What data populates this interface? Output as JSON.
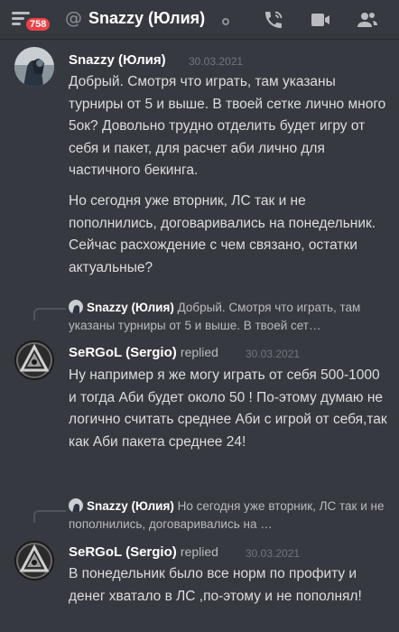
{
  "header": {
    "unread_count": "758",
    "at_symbol": "@",
    "channel_title": "Snazzy (Юлия)"
  },
  "messages": [
    {
      "author": "Snazzy (Юлия)",
      "timestamp": "30.03.2021",
      "paragraphs": [
        "Добрый. Смотря что играть, там указаны турниры от 5 и выше. В твоей сетке лично много 5ок? Довольно трудно отделить будет игру от себя и пакет, для расчет аби лично для частичного бекинга.",
        "Но сегодня уже вторник, ЛС так и не пополнились, договаривались на понедельник. Сейчас расхождение с чем связано, остатки актуальные?"
      ]
    },
    {
      "reply_author": "Snazzy (Юлия)",
      "reply_text": "Добрый. Смотря что играть, там указаны турниры от 5 и выше. В твоей сет…",
      "author": "SeRGoL (Sergio)",
      "replied_label": "replied",
      "timestamp": "30.03.2021",
      "paragraphs": [
        "Ну например я же могу играть от себя 500-1000 и тогда Аби будет около 50 ! По-этому думаю не логично считать среднее Аби с игрой от себя,так как Аби пакета среднее 24!"
      ]
    },
    {
      "reply_author": "Snazzy (Юлия)",
      "reply_text": "Но сегодня уже вторник, ЛС так и не пополнились, договаривались на …",
      "author": "SeRGoL (Sergio)",
      "replied_label": "replied",
      "timestamp": "30.03.2021",
      "paragraphs": [
        "В понедельник было все норм по профиту и денег хватало в ЛС ,по-этому и не пополнял!"
      ]
    }
  ],
  "colors": {
    "background": "#36393f",
    "badge": "#ed4245",
    "muted_text": "#b9bbbe",
    "timestamp": "#72767d"
  },
  "icons": [
    "hamburger-menu-icon",
    "at-icon",
    "status-offline-icon",
    "call-icon",
    "video-icon",
    "members-icon"
  ]
}
